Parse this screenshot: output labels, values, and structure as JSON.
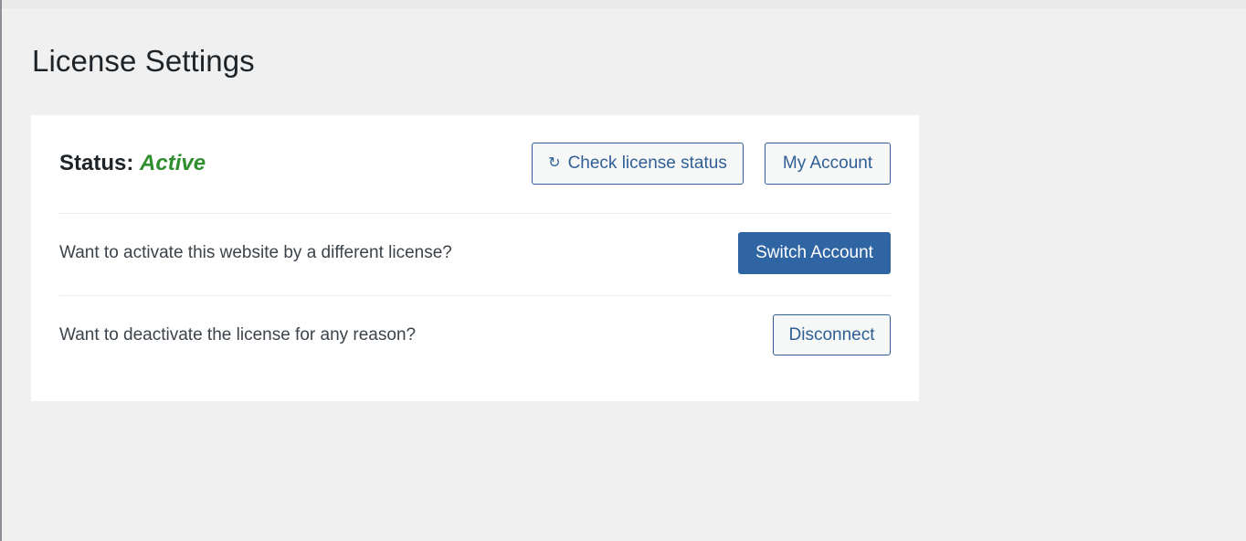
{
  "page": {
    "title": "License Settings"
  },
  "status": {
    "label": "Status:",
    "value": "Active"
  },
  "buttons": {
    "check_license": "Check license status",
    "my_account": "My Account",
    "switch_account": "Switch Account",
    "disconnect": "Disconnect"
  },
  "rows": {
    "switch_text": "Want to activate this website by a different license?",
    "disconnect_text": "Want to deactivate the license for any reason?"
  },
  "icons": {
    "refresh": "refresh-icon"
  },
  "colors": {
    "accent": "#2f65a3",
    "active": "#2f8f2f"
  }
}
